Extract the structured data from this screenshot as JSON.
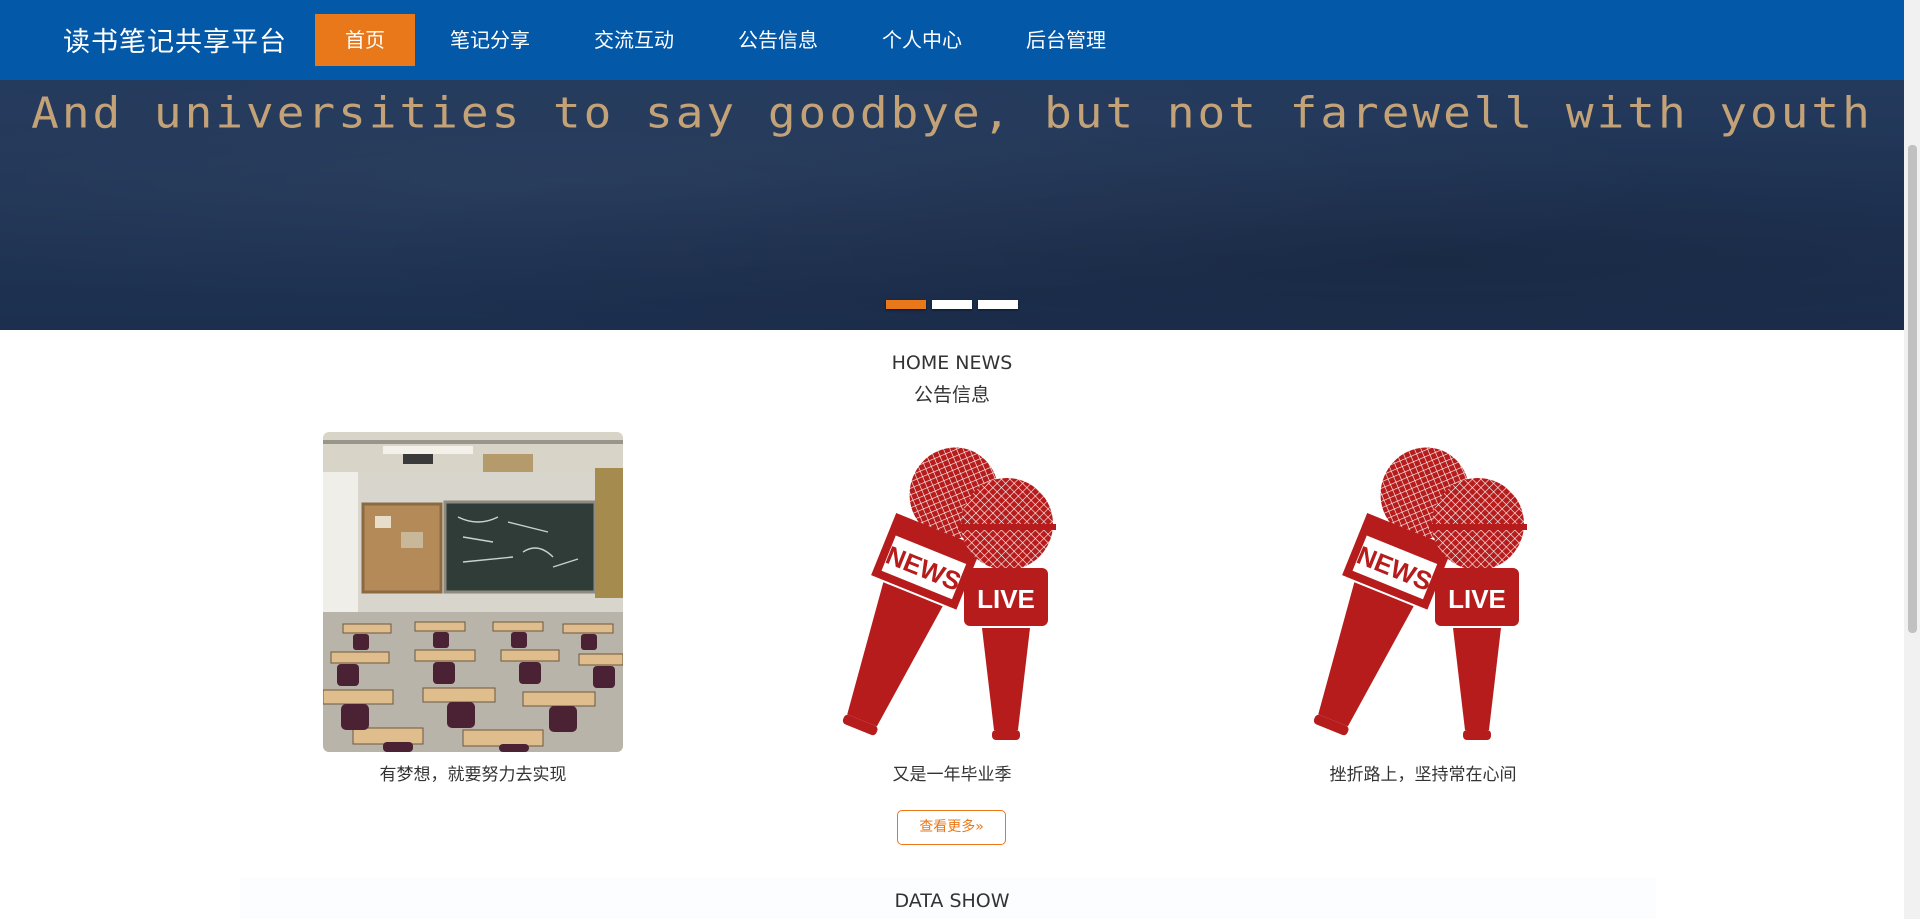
{
  "header": {
    "brand": "读书笔记共享平台",
    "nav": [
      {
        "label": "首页",
        "active": true
      },
      {
        "label": "笔记分享",
        "active": false
      },
      {
        "label": "交流互动",
        "active": false
      },
      {
        "label": "公告信息",
        "active": false
      },
      {
        "label": "个人中心",
        "active": false
      },
      {
        "label": "后台管理",
        "active": false
      }
    ]
  },
  "banner": {
    "text": "And universities to say goodbye, but not farewell with youth",
    "slides": 3,
    "active_slide": 1
  },
  "news": {
    "title": "HOME NEWS",
    "subtitle": "公告信息",
    "items": [
      {
        "caption": "有梦想，就要努力去实现",
        "image": "classroom-photo"
      },
      {
        "caption": "又是一年毕业季",
        "image": "news-live-microphones"
      },
      {
        "caption": "挫折路上，坚持常在心间",
        "image": "news-live-microphones"
      }
    ],
    "more_label": "查看更多"
  },
  "data_show": {
    "title": "DATA SHOW"
  },
  "colors": {
    "header": "#0458a8",
    "accent": "#e9781a",
    "banner": "#1f3354",
    "mic_red": "#b71c1c"
  }
}
